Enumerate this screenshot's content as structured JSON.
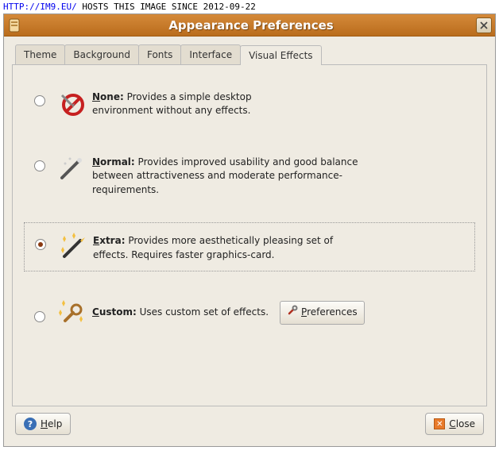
{
  "banner": {
    "link_text": "HTTP://IM9.EU/",
    "after_text": " HOSTS THIS IMAGE SINCE 2012-09-22"
  },
  "window": {
    "title": "Appearance Preferences"
  },
  "tabs": [
    "Theme",
    "Background",
    "Fonts",
    "Interface",
    "Visual Effects"
  ],
  "options": {
    "none": {
      "title_u": "N",
      "title_rest": "one:",
      "desc": " Provides a simple desktop environment without any effects."
    },
    "normal": {
      "title_u": "N",
      "title_rest": "ormal:",
      "desc": " Provides improved usability and good balance between attractiveness and moderate performance-requirements."
    },
    "extra": {
      "title_u": "E",
      "title_rest": "xtra:",
      "desc": " Provides more aesthetically pleasing set of effects. Requires faster graphics-card."
    },
    "custom": {
      "title_u": "C",
      "title_rest": "ustom:",
      "desc": " Uses custom set of effects.",
      "button_u": "P",
      "button_rest": "references"
    }
  },
  "footer": {
    "help_u": "H",
    "help_rest": "elp",
    "close_u": "C",
    "close_rest": "lose"
  }
}
